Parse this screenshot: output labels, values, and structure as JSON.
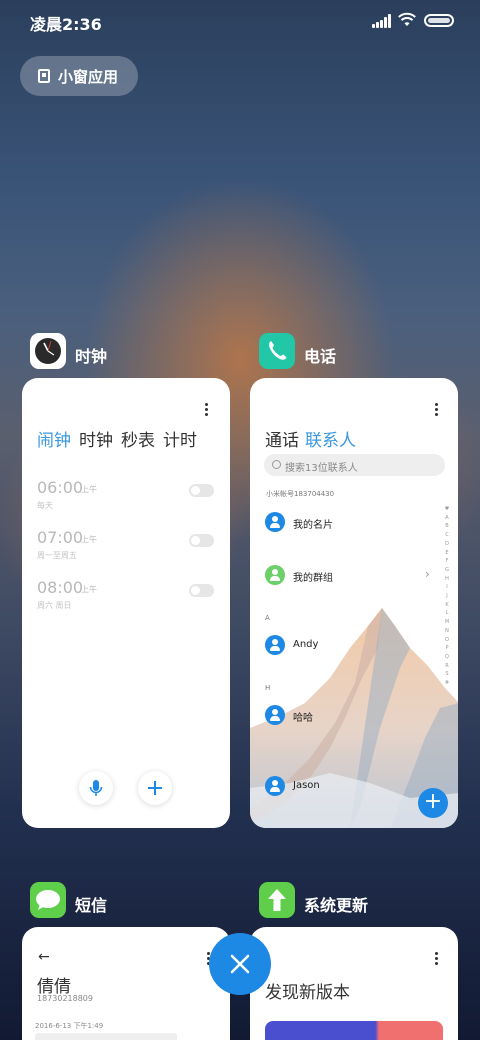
{
  "status_bar": {
    "time": "凌晨2:36"
  },
  "floating_window_button": {
    "label": "小窗应用"
  },
  "apps": {
    "clock": {
      "label": "时钟",
      "tabs": [
        "闹钟",
        "时钟",
        "秒表",
        "计时"
      ],
      "active_tab": "闹钟",
      "alarms": [
        {
          "time": "06:00",
          "ampm": "上午",
          "days": "每天",
          "enabled": false
        },
        {
          "time": "07:00",
          "ampm": "上午",
          "days": "周一至周五",
          "enabled": false
        },
        {
          "time": "08:00",
          "ampm": "上午",
          "days": "周六 周日",
          "enabled": false
        }
      ]
    },
    "contacts": {
      "label": "电话",
      "tabs": [
        "通话",
        "联系人"
      ],
      "active_tab": "联系人",
      "search_placeholder": "搜索13位联系人",
      "account": "小米帐号183704430",
      "my_card": "我的名片",
      "my_groups": "我的群组",
      "sections": [
        {
          "letter": "A",
          "name": "Andy"
        },
        {
          "letter": "H",
          "name": "哈哈"
        },
        {
          "letter": "",
          "name": "Jason"
        }
      ],
      "index": "♥ A B C D E F G H I J K L M N O P Q R S #"
    },
    "messages": {
      "label": "短信",
      "back_glyph": "←",
      "contact_name": "倩倩",
      "contact_number": "18730218809",
      "last_time": "2016-6-13 下午1:49"
    },
    "updater": {
      "label": "系统更新",
      "title": "发现新版本"
    }
  },
  "colors": {
    "accent": "#1e88e5",
    "active_tab": "#3a97e0",
    "clock_icon_bg": "#ffffff",
    "phone_icon_bg": "#21c7a6",
    "messages_icon_bg": "#5fcf4b",
    "updater_icon_bg": "#5fcf4b"
  },
  "icons": [
    "signal-icon",
    "wifi-icon",
    "battery-icon",
    "floating-window-icon",
    "clock-app-icon",
    "phone-app-icon",
    "messages-app-icon",
    "update-app-icon",
    "microphone-icon",
    "plus-icon",
    "search-icon",
    "close-icon"
  ]
}
